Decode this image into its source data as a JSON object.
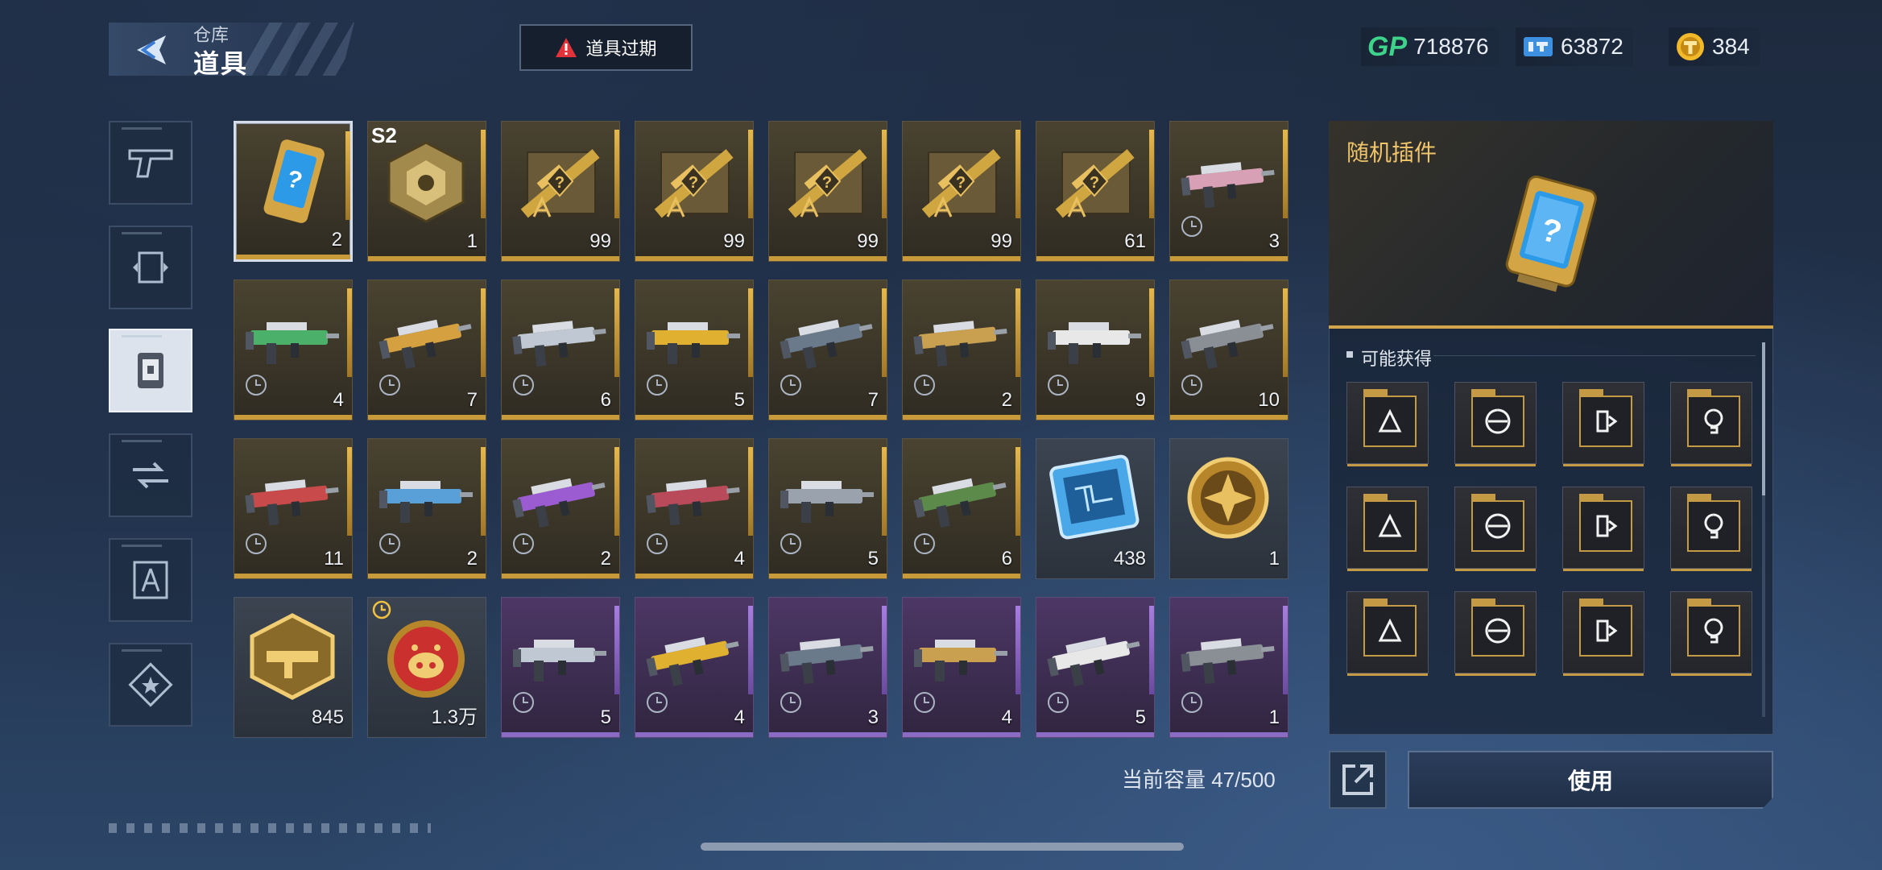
{
  "header": {
    "breadcrumb": "仓库",
    "title": "道具",
    "expire_button": "道具过期",
    "currencies": [
      {
        "icon": "gp-icon",
        "label": "GP",
        "value": "718876"
      },
      {
        "icon": "ticket-icon",
        "value": "63872"
      },
      {
        "icon": "gold-coin-icon",
        "value": "384"
      }
    ]
  },
  "categories": [
    {
      "name": "weapon",
      "icon": "pistol-icon",
      "active": false
    },
    {
      "name": "frame",
      "icon": "frame-icon",
      "active": false
    },
    {
      "name": "items",
      "icon": "item-box-icon",
      "active": true
    },
    {
      "name": "transfer",
      "icon": "exchange-icon",
      "active": false
    },
    {
      "name": "blueprint",
      "icon": "blueprint-icon",
      "active": false
    },
    {
      "name": "medal",
      "icon": "star-badge-icon",
      "active": false
    }
  ],
  "items": [
    {
      "icon": "random-plugin-icon",
      "qty": "2",
      "rarity": "gold",
      "selected": true
    },
    {
      "icon": "s2-crate-icon",
      "qty": "1",
      "tag": "S2",
      "rarity": "gold"
    },
    {
      "icon": "gold-rifle-blueprint-icon",
      "qty": "99",
      "rarity": "gold"
    },
    {
      "icon": "gold-rifle-blueprint-icon",
      "qty": "99",
      "rarity": "gold"
    },
    {
      "icon": "gold-rifle-blueprint-icon",
      "qty": "99",
      "rarity": "gold"
    },
    {
      "icon": "gold-rifle-blueprint-icon",
      "qty": "99",
      "rarity": "gold"
    },
    {
      "icon": "gold-rifle-blueprint-icon",
      "qty": "61",
      "rarity": "gold"
    },
    {
      "icon": "gold-smg-icon",
      "qty": "3",
      "rarity": "gold"
    },
    {
      "icon": "red-rifle-icon",
      "qty": "4",
      "rarity": "gold"
    },
    {
      "icon": "blue-rifle-icon",
      "qty": "7",
      "rarity": "gold"
    },
    {
      "icon": "purple-smg-icon",
      "qty": "6",
      "rarity": "gold"
    },
    {
      "icon": "red-pistol-icon",
      "qty": "5",
      "rarity": "gold"
    },
    {
      "icon": "grey-sniper-icon",
      "qty": "7",
      "rarity": "gold"
    },
    {
      "icon": "green-rifle-icon",
      "qty": "2",
      "rarity": "gold"
    },
    {
      "icon": "violet-rifle-icon",
      "qty": "9",
      "rarity": "gold"
    },
    {
      "icon": "pink-shotgun-icon",
      "qty": "10",
      "rarity": "gold"
    },
    {
      "icon": "green-launcher-icon",
      "qty": "11",
      "rarity": "gold"
    },
    {
      "icon": "gold-pistol-icon",
      "qty": "2",
      "rarity": "gold"
    },
    {
      "icon": "dagger-icon",
      "qty": "2",
      "rarity": "gold"
    },
    {
      "icon": "yellow-rifle-icon",
      "qty": "4",
      "rarity": "gold"
    },
    {
      "icon": "dark-rifle-icon",
      "qty": "5",
      "rarity": "gold"
    },
    {
      "icon": "gold-revolver-icon",
      "qty": "6",
      "rarity": "gold"
    },
    {
      "icon": "chip-card-icon",
      "qty": "438",
      "rarity": "none"
    },
    {
      "icon": "gold-medal-coin-icon",
      "qty": "1",
      "rarity": "none"
    },
    {
      "icon": "gold-weapon-badge-icon",
      "qty": "845",
      "rarity": "none"
    },
    {
      "icon": "pig-coin-icon",
      "qty": "1.3万",
      "rarity": "none",
      "timed": true
    },
    {
      "icon": "white-shotgun-icon",
      "qty": "5",
      "rarity": "purple"
    },
    {
      "icon": "silver-launcher-icon",
      "qty": "4",
      "rarity": "purple"
    },
    {
      "icon": "camo-rifle-icon",
      "qty": "3",
      "rarity": "purple"
    },
    {
      "icon": "red-white-rifle-icon",
      "qty": "4",
      "rarity": "purple"
    },
    {
      "icon": "white-smg-icon",
      "qty": "5",
      "rarity": "purple"
    },
    {
      "icon": "green-smg-icon",
      "qty": "1",
      "rarity": "purple"
    }
  ],
  "capacity_text": "当前容量 47/500",
  "detail": {
    "name": "随机插件",
    "section_title": "可能获得",
    "plugins": [
      "bullets-plugin-icon",
      "crosshair-plugin-icon",
      "magazine-plugin-icon",
      "bulb-plugin-icon",
      "warning-ammo-plugin-icon",
      "target-plugin-icon",
      "rocket-plugin-icon",
      "gun-plugin-icon",
      "shield-plugin-icon",
      "stack-plugin-icon",
      "reticle-plugin-icon",
      "dash-plugin-icon"
    ],
    "use_button": "使用"
  }
}
